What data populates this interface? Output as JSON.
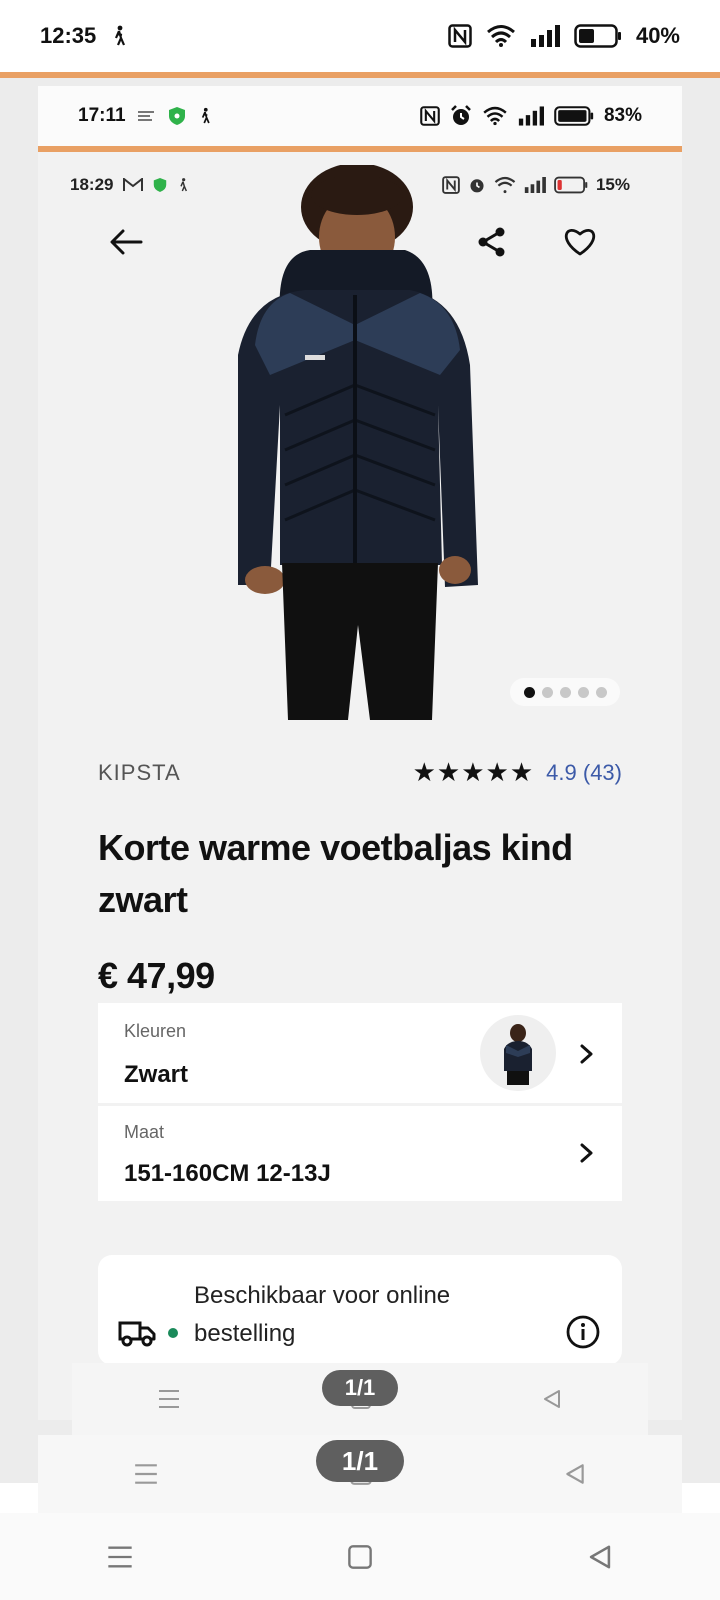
{
  "status_outer": {
    "time": "12:35",
    "battery": "40%"
  },
  "status_inner": {
    "time": "17:11",
    "battery": "83%"
  },
  "status_page": {
    "time": "18:29",
    "battery": "15%"
  },
  "gallery": {
    "active_index": 0,
    "total": 5
  },
  "product": {
    "brand": "KIPSTA",
    "stars": "★★★★★",
    "rating": "4.9 (43)",
    "title": "Korte warme voetbaljas kind zwart",
    "price": "€ 47,99"
  },
  "options": {
    "color": {
      "label": "Kleuren",
      "value": "Zwart"
    },
    "size": {
      "label": "Maat",
      "value": "151-160CM 12-13J"
    }
  },
  "availability": {
    "text": "Beschikbaar voor online bestelling",
    "status_color": "#1a8a5a"
  },
  "page_indicator": {
    "small": "1/1",
    "large": "1/1"
  },
  "colors": {
    "accent_line": "#e9a064",
    "rating_blue": "#3c5aa8"
  }
}
